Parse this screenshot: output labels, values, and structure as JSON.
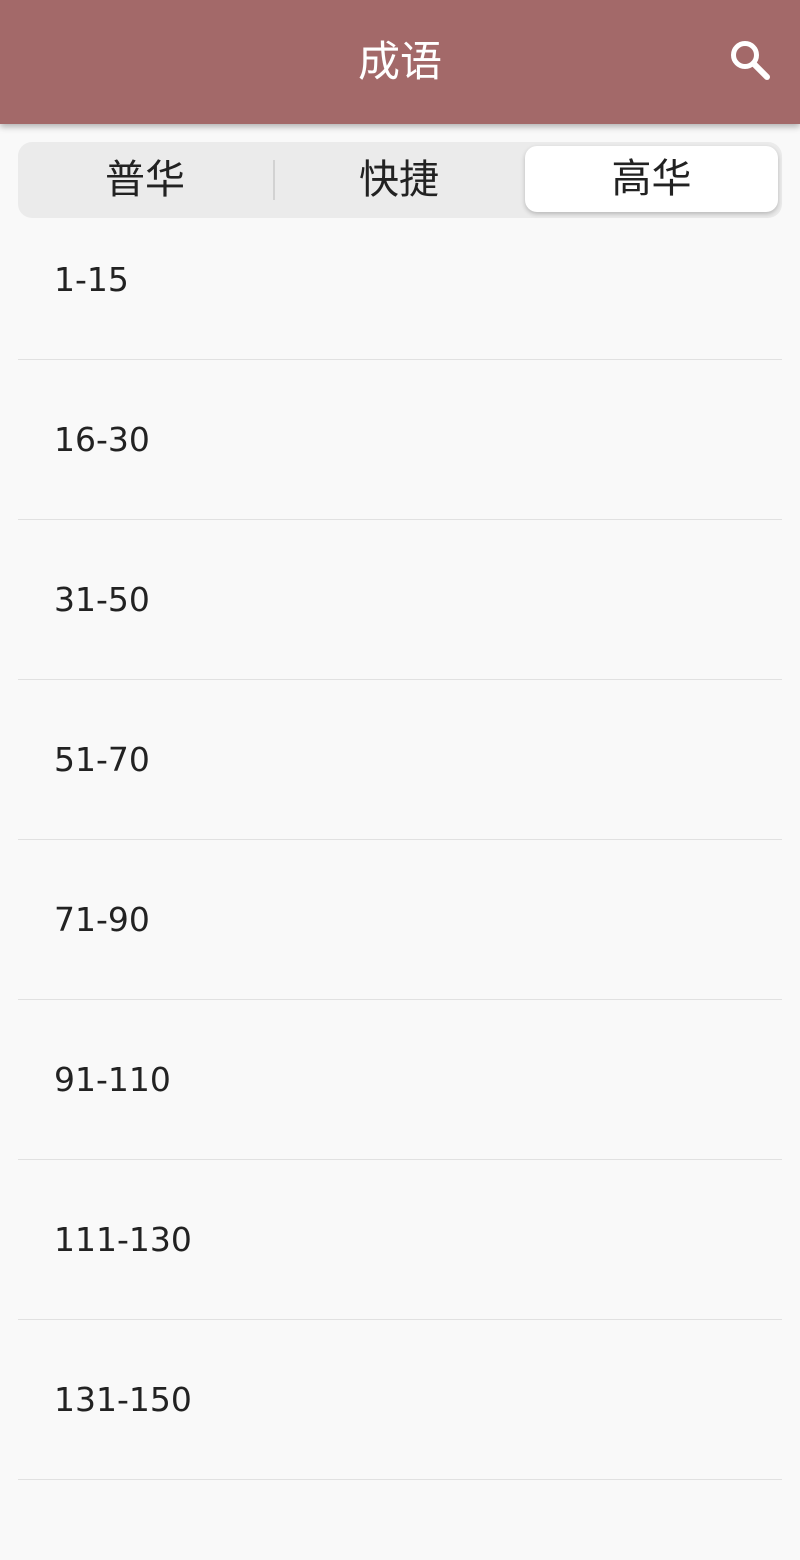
{
  "app_bar": {
    "title": "成语",
    "search_icon": "search-icon",
    "color": "#a36969"
  },
  "tabs": [
    {
      "label": "普华",
      "selected": false
    },
    {
      "label": "快捷",
      "selected": false
    },
    {
      "label": "高华",
      "selected": true
    }
  ],
  "list": {
    "items": [
      {
        "label": "1-15"
      },
      {
        "label": "16-30"
      },
      {
        "label": "31-50"
      },
      {
        "label": "51-70"
      },
      {
        "label": "71-90"
      },
      {
        "label": "91-110"
      },
      {
        "label": "111-130"
      },
      {
        "label": "131-150"
      }
    ]
  }
}
